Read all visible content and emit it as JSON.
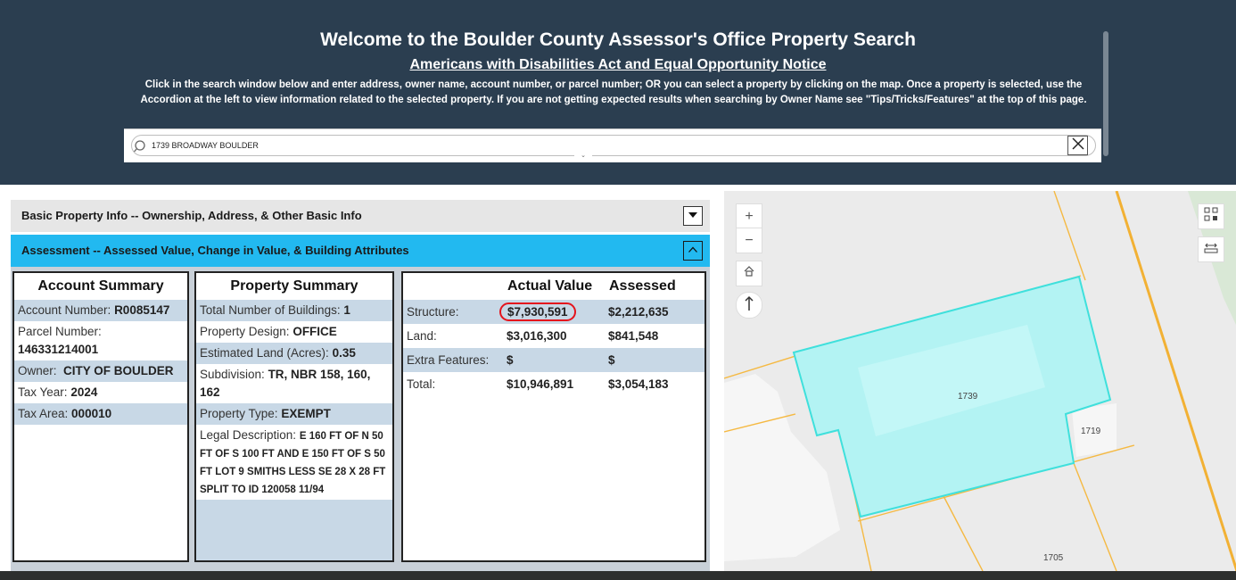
{
  "header": {
    "title": "Welcome to the Boulder County Assessor's Office Property Search",
    "notice_link": "Americans with Disabilities Act and Equal Opportunity Notice",
    "instructions": "Click in the search window below and enter address, owner name, account number, or parcel number; OR you can select a property by clicking on the map. Once a property is selected, use the Accordion at the left to view information related to the selected property. If you are not getting expected results when searching by Owner Name see \"Tips/Tricks/Features\" at the top of this page.",
    "background": "#2b3e50"
  },
  "search": {
    "value": "1739 BROADWAY  BOULDER",
    "icon": "search-icon",
    "clear_icon": "close-icon"
  },
  "accordion": {
    "basic": {
      "label": "Basic Property Info -- Ownership, Address, & Other Basic Info",
      "state": "collapsed"
    },
    "assessment": {
      "label": "Assessment -- Assessed Value, Change in Value, & Building Attributes",
      "state": "expanded",
      "color": "#22b9f0"
    }
  },
  "account_summary": {
    "title": "Account Summary",
    "rows": [
      {
        "label": "Account Number:",
        "value": "R0085147"
      },
      {
        "label": "Parcel Number:",
        "value": "146331214001"
      },
      {
        "label": "Owner:",
        "value": "CITY OF BOULDER"
      },
      {
        "label": "Tax Year:",
        "value": "2024"
      },
      {
        "label": "Tax Area:",
        "value": "000010"
      }
    ]
  },
  "property_summary": {
    "title": "Property Summary",
    "rows": [
      {
        "label": "Total Number of Buildings:",
        "value": "1"
      },
      {
        "label": "Property Design:",
        "value": "OFFICE"
      },
      {
        "label": "Estimated Land (Acres):",
        "value": "0.35"
      },
      {
        "label": "Subdivision:",
        "value": "TR, NBR 158, 160, 162"
      },
      {
        "label": "Property Type:",
        "value": "EXEMPT"
      },
      {
        "label": "Legal Description:",
        "value": "E 160 FT OF N 50 FT OF S 100 FT AND E 150 FT OF S 50 FT LOT 9 SMITHS LESS SE 28 X 28 FT SPLIT TO  ID 120058 11/94"
      }
    ]
  },
  "values": {
    "col_actual": "Actual Value",
    "col_assessed": "Assessed",
    "rows": [
      {
        "label": "Structure:",
        "actual": "$7,930,591",
        "assessed": "$2,212,635"
      },
      {
        "label": "Land:",
        "actual": "$3,016,300",
        "assessed": "$841,548"
      },
      {
        "label": "Extra Features:",
        "actual": "$",
        "assessed": "$"
      },
      {
        "label": "Total:",
        "actual": "$10,946,891",
        "assessed": "$3,054,183"
      }
    ],
    "highlight_color": "#e5131c"
  },
  "map": {
    "parcel_labels": {
      "main": "1739",
      "east": "1719",
      "south": "1705"
    },
    "selected_fill": "#b3f3f3",
    "selected_outline": "#3fe0dc",
    "parcel_line_color": "#f5b942",
    "controls": {
      "zoom_in": "+",
      "zoom_out": "−",
      "home_icon": "home-icon",
      "north_icon": "north-arrow-icon",
      "qr_icon": "qr-code-icon",
      "measure_icon": "measure-icon"
    }
  }
}
